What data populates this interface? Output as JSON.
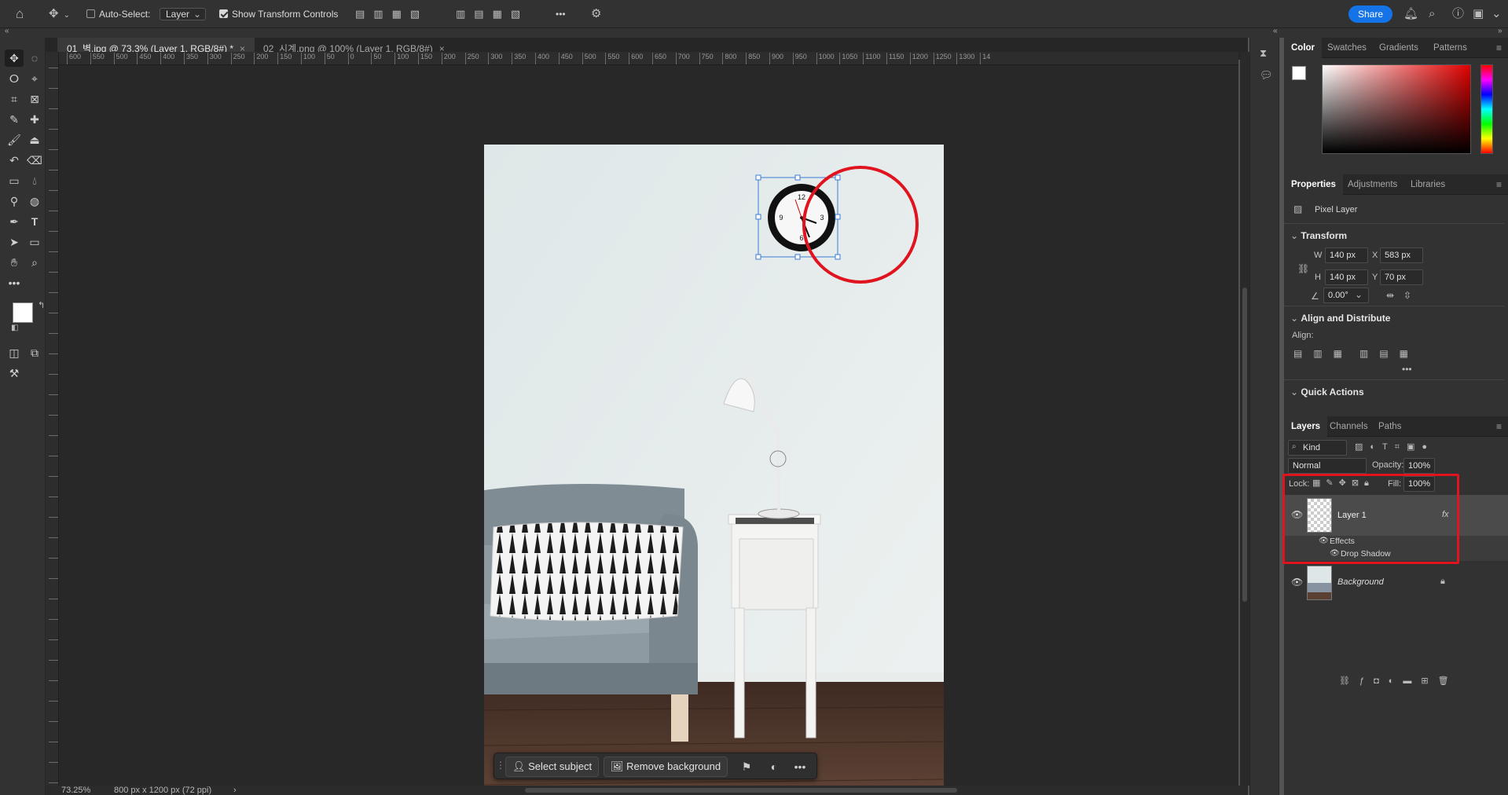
{
  "options_bar": {
    "auto_select_label": "Auto-Select:",
    "auto_select_target": "Layer",
    "show_transform_label": "Show Transform Controls",
    "more": "•••",
    "share_label": "Share"
  },
  "tabs": [
    {
      "label": "01_벽.jpg @ 73.3% (Layer 1, RGB/8#) *",
      "close": "×"
    },
    {
      "label": "02_시계.png @ 100% (Layer 1, RGB/8#)",
      "close": "×"
    }
  ],
  "ruler_top_ticks": [
    "600",
    "550",
    "500",
    "450",
    "400",
    "350",
    "300",
    "250",
    "200",
    "150",
    "100",
    "50",
    "0",
    "50",
    "100",
    "150",
    "200",
    "250",
    "300",
    "350",
    "400",
    "450",
    "500",
    "550",
    "600",
    "650",
    "700",
    "750",
    "800",
    "850",
    "900",
    "950",
    "1000",
    "1050",
    "1100",
    "1150",
    "1200",
    "1250",
    "1300",
    "14"
  ],
  "context_bar": {
    "select_subject": "Select subject",
    "remove_background": "Remove background",
    "more": "•••"
  },
  "status": {
    "zoom": "73.25%",
    "doc_size": "800 px x 1200 px (72 ppi)",
    "arrow": "›"
  },
  "color_panel": {
    "tabs": [
      "Color",
      "Swatches",
      "Gradients",
      "Patterns"
    ],
    "hue_color": "#e00000"
  },
  "properties_panel": {
    "tabs": [
      "Properties",
      "Adjustments",
      "Libraries"
    ],
    "layer_type": "Pixel Layer",
    "transform_title": "Transform",
    "w_label": "W",
    "w_value": "140 px",
    "h_label": "H",
    "h_value": "140 px",
    "x_label": "X",
    "x_value": "583 px",
    "y_label": "Y",
    "y_value": "70 px",
    "angle_value": "0.00°",
    "align_title": "Align and Distribute",
    "align_label": "Align:",
    "more": "•••",
    "quick_actions_title": "Quick Actions"
  },
  "layers_panel": {
    "tabs": [
      "Layers",
      "Channels",
      "Paths"
    ],
    "filter_kind": "Kind",
    "blend_mode": "Normal",
    "opacity_label": "Opacity:",
    "opacity_value": "100%",
    "lock_label": "Lock:",
    "fill_label": "Fill:",
    "fill_value": "100%",
    "layers": [
      {
        "name": "Layer 1",
        "fx": "fx"
      },
      {
        "name": "Background"
      }
    ],
    "effects_label": "Effects",
    "drop_shadow_label": "Drop Shadow"
  },
  "colors": {
    "accent": "#1473e6",
    "annotation_red": "#e0141e"
  }
}
